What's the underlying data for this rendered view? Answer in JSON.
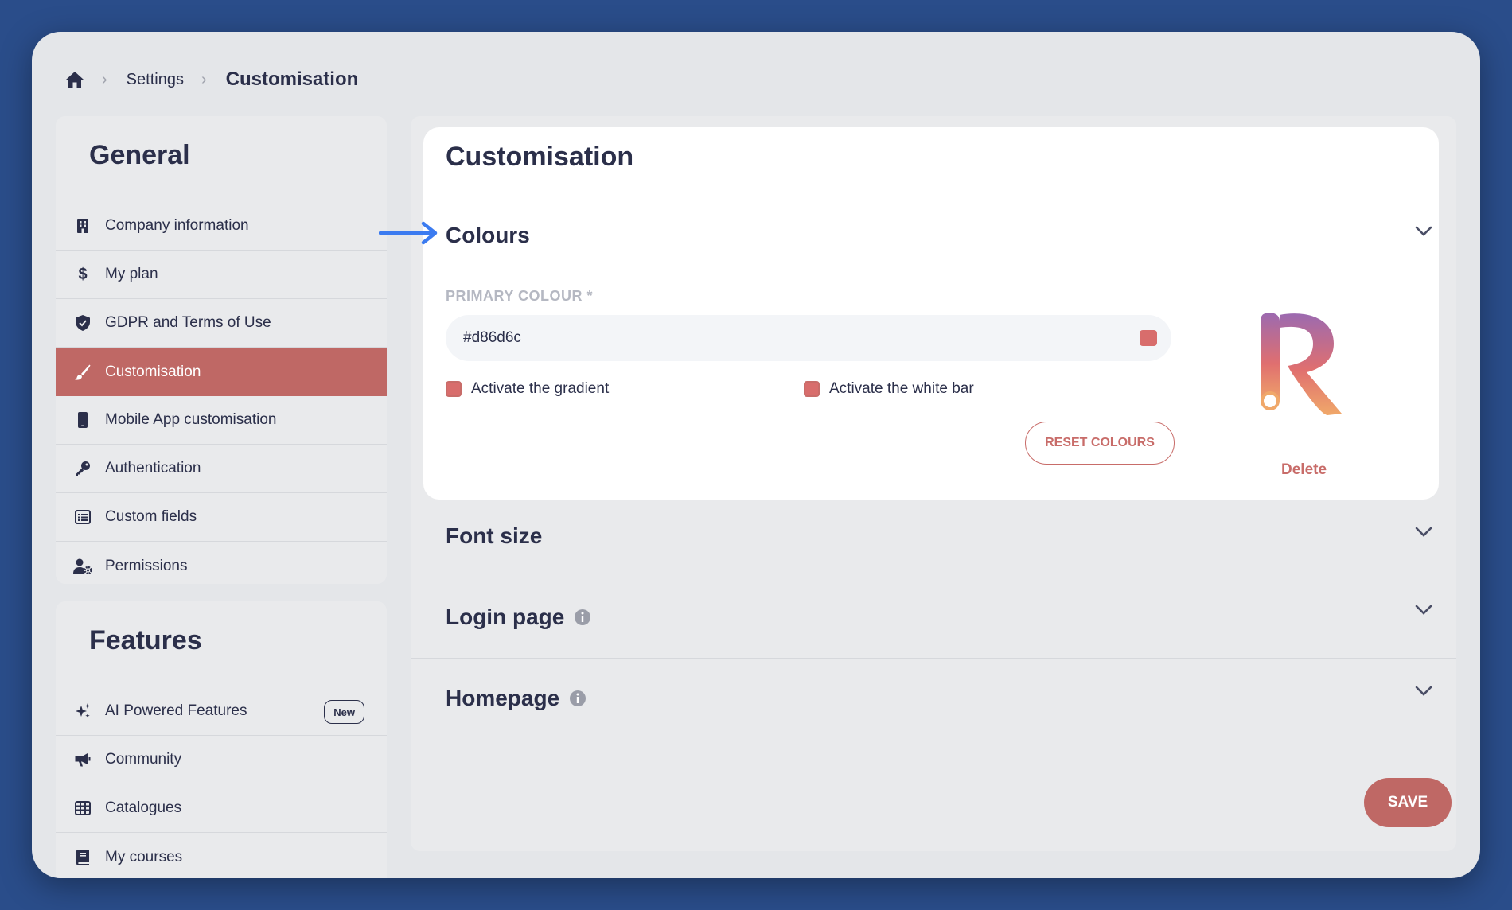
{
  "breadcrumb": {
    "home_icon": "home-icon",
    "items": [
      "Settings",
      "Customisation"
    ]
  },
  "sidebar": {
    "general": {
      "title": "General",
      "items": [
        {
          "label": "Company information",
          "icon": "building-icon"
        },
        {
          "label": "My plan",
          "icon": "dollar-icon"
        },
        {
          "label": "GDPR and Terms of Use",
          "icon": "shield-icon"
        },
        {
          "label": "Customisation",
          "icon": "brush-icon",
          "active": true
        },
        {
          "label": "Mobile App customisation",
          "icon": "phone-icon"
        },
        {
          "label": "Authentication",
          "icon": "key-icon"
        },
        {
          "label": "Custom fields",
          "icon": "list-icon"
        },
        {
          "label": "Permissions",
          "icon": "user-gear-icon"
        }
      ]
    },
    "features": {
      "title": "Features",
      "items": [
        {
          "label": "AI Powered Features",
          "icon": "sparkle-icon",
          "badge": "New"
        },
        {
          "label": "Community",
          "icon": "megaphone-icon"
        },
        {
          "label": "Catalogues",
          "icon": "grid-icon"
        },
        {
          "label": "My courses",
          "icon": "book-icon"
        }
      ]
    }
  },
  "main": {
    "title": "Customisation",
    "colours": {
      "title": "Colours",
      "primary_label": "PRIMARY COLOUR *",
      "primary_value": "#d86d6c",
      "checkbox_gradient": "Activate the gradient",
      "checkbox_white_bar": "Activate the white bar",
      "reset_label": "RESET COLOURS",
      "delete_label": "Delete"
    },
    "sections": [
      {
        "label": "Font size",
        "info": false
      },
      {
        "label": "Login page",
        "info": true
      },
      {
        "label": "Homepage",
        "info": true
      }
    ],
    "save_label": "SAVE"
  },
  "colors": {
    "accent": "#bf6865",
    "primary_swatch": "#d86d6c",
    "pointer_arrow": "#3b7bf0"
  }
}
